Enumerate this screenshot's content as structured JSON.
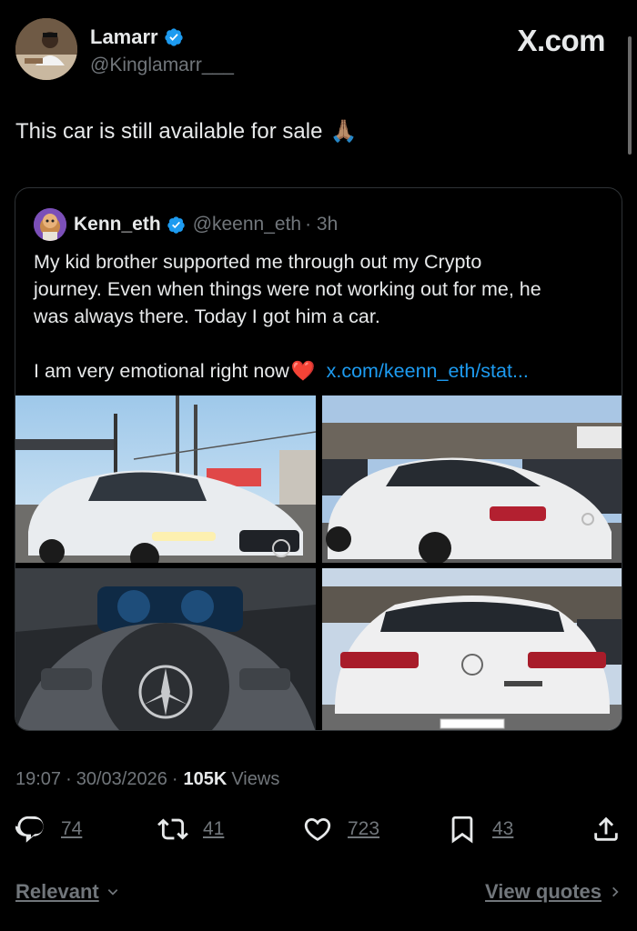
{
  "post": {
    "author_name": "Lamarr",
    "author_handle": "@Kinglamarr___",
    "brand": "X.com",
    "text": "This car is still available for sale",
    "emoji": "🙏🏽"
  },
  "quoted": {
    "author_name": "Kenn_eth",
    "author_handle": "@keenn_eth",
    "time": "· 3h",
    "lines": [
      "My kid brother supported me through out my Crypto",
      "journey. Even when things were not working out for me, he",
      "was always there. Today I got him a car."
    ],
    "last_line": "I am very emotional right now",
    "heart": "❤️",
    "link": "x.com/keenn_eth/stat..."
  },
  "meta": {
    "time": "19:07",
    "date": "30/03/2026",
    "views_count": "105K",
    "views_label": "Views"
  },
  "actions": {
    "replies": "74",
    "reposts": "41",
    "likes": "723",
    "bookmarks": "43"
  },
  "footer": {
    "sort_label": "Relevant",
    "view_quotes": "View quotes"
  },
  "colors": {
    "accent": "#1d9bf0",
    "muted": "#71767b",
    "text": "#e7e9ea",
    "background": "#000000",
    "border": "#2f3336"
  }
}
